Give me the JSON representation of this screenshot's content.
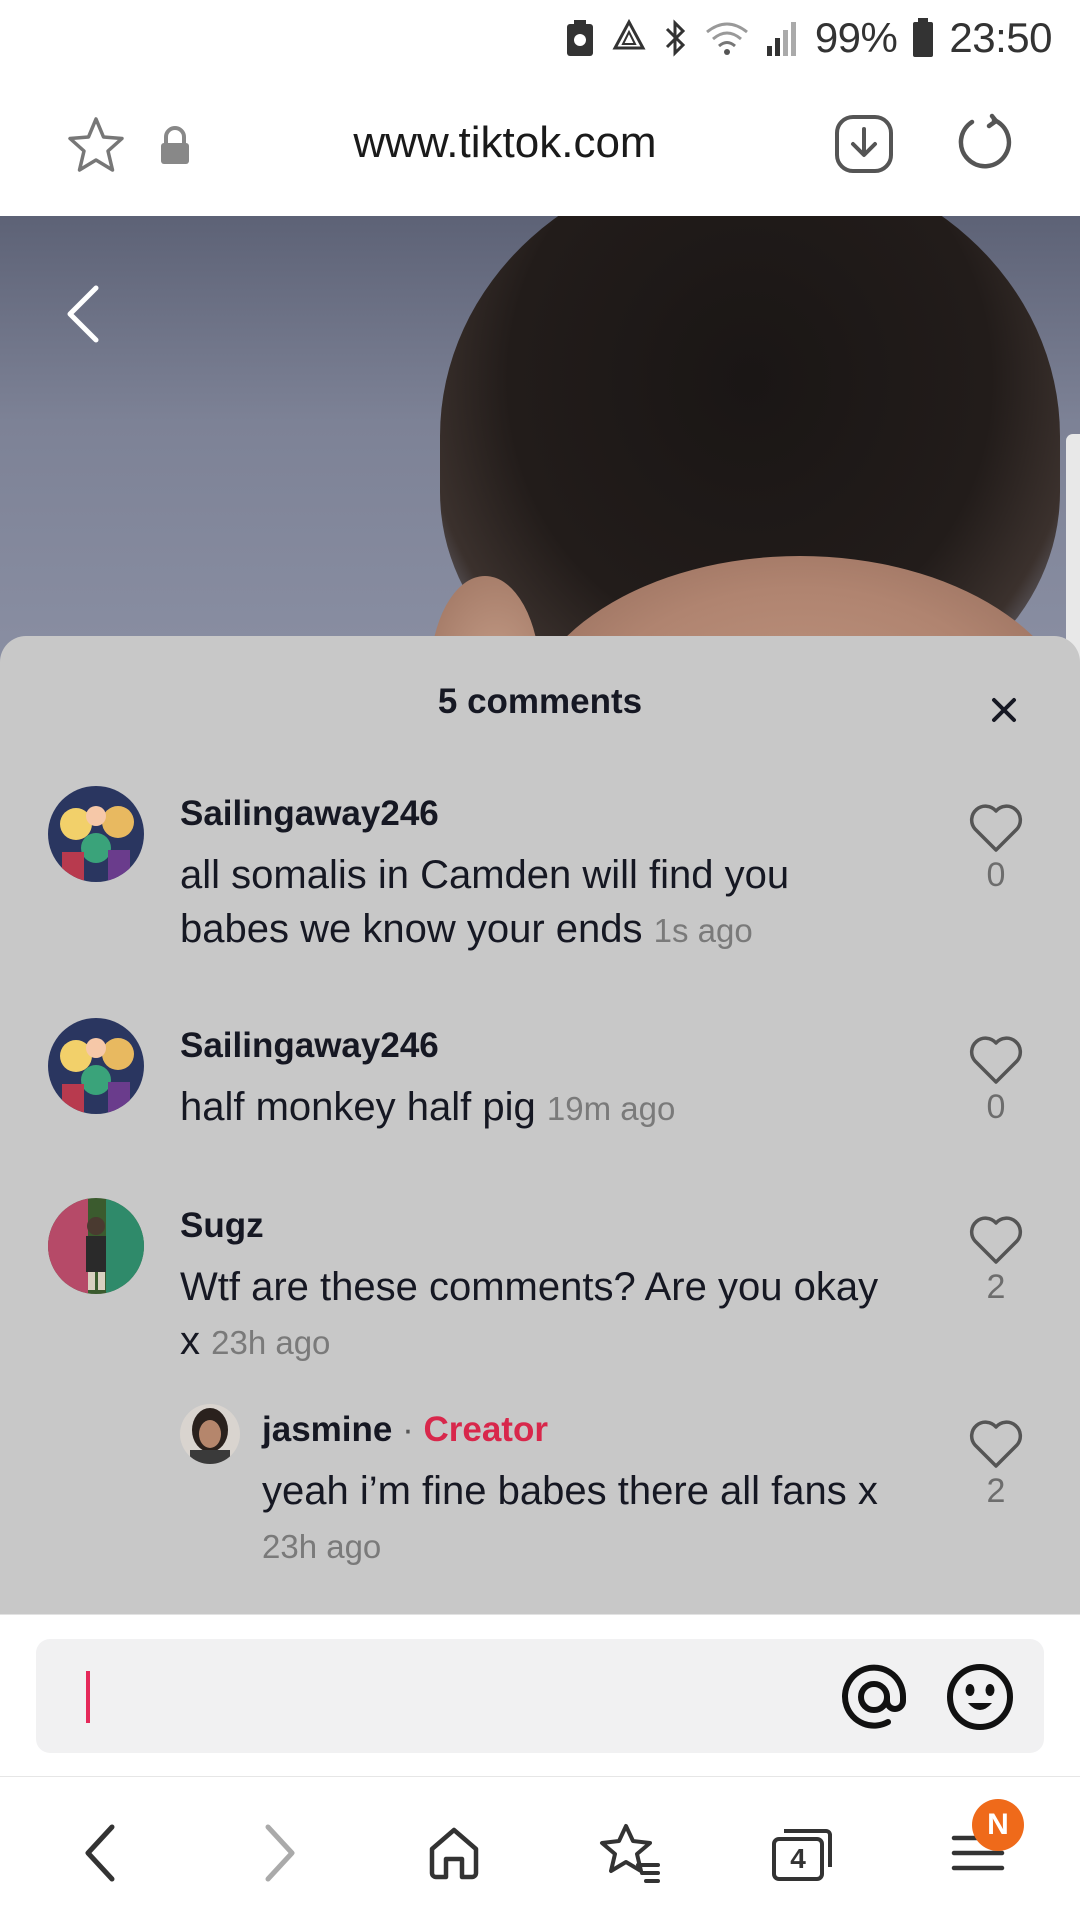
{
  "status_bar": {
    "battery_percent": "99%",
    "time": "23:50",
    "icons": [
      "save-icon",
      "recycle-icon",
      "bluetooth-icon",
      "wifi-icon",
      "signal-icon",
      "battery-icon"
    ]
  },
  "browser": {
    "url": "www.tiktok.com",
    "icons": [
      "bookmark-star-icon",
      "lock-icon",
      "download-icon",
      "reload-icon"
    ]
  },
  "comments_sheet": {
    "title": "5 comments",
    "comments": [
      {
        "username": "Sailingaway246",
        "text": "all somalis in Camden will find you babes we know your ends",
        "time": "1s ago",
        "likes": "0"
      },
      {
        "username": "Sailingaway246",
        "text": "half monkey half pig",
        "time": "19m ago",
        "likes": "0"
      },
      {
        "username": "Sugz",
        "text": "Wtf are these comments? Are you okay x",
        "time": "23h ago",
        "likes": "2"
      }
    ],
    "reply": {
      "username": "jasmine",
      "separator": "·",
      "creator_label": "Creator",
      "text": "yeah i’m fine babes there all fans x",
      "time": "23h ago",
      "likes": "2"
    }
  },
  "comment_input": {
    "value": "",
    "icons": [
      "mention-icon",
      "emoji-icon"
    ]
  },
  "bottom_nav": {
    "tabs_count": "4",
    "notification_badge": "N",
    "icons": [
      "back-icon",
      "forward-icon",
      "home-icon",
      "bookmarks-icon",
      "tabs-icon",
      "menu-icon"
    ]
  },
  "colors": {
    "creator": "#d8274b",
    "sheet_bg": "#c8c8c8",
    "badge": "#ef6a1a",
    "caret": "#e5295a"
  }
}
